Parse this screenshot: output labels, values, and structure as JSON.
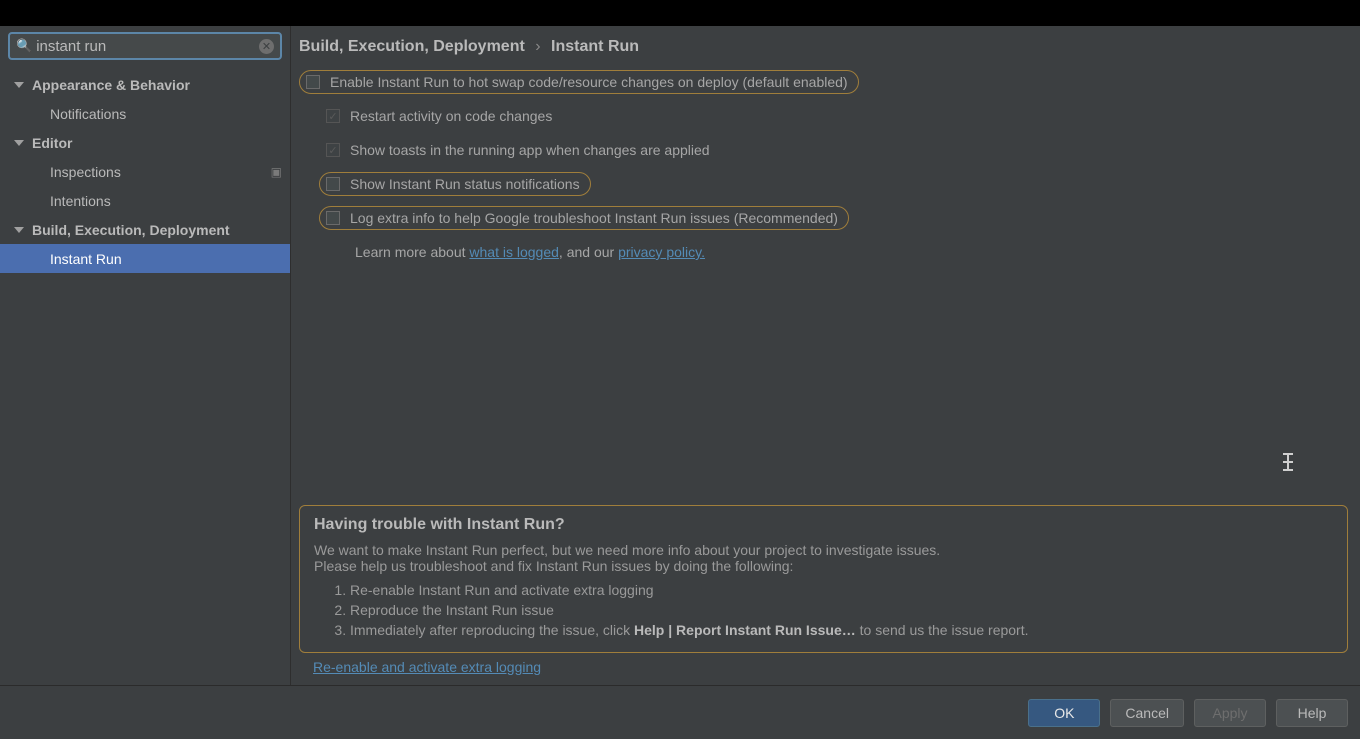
{
  "search": {
    "value": "instant run"
  },
  "sidebar": {
    "groups": [
      {
        "label": "Appearance & Behavior",
        "children": [
          {
            "label": "Notifications"
          }
        ]
      },
      {
        "label": "Editor",
        "children": [
          {
            "label": "Inspections",
            "badge": true
          },
          {
            "label": "Intentions"
          }
        ]
      },
      {
        "label": "Build, Execution, Deployment",
        "children": [
          {
            "label": "Instant Run",
            "selected": true
          }
        ]
      }
    ]
  },
  "breadcrumb": {
    "root": "Build, Execution, Deployment",
    "leaf": "Instant Run"
  },
  "options": {
    "enable": "Enable Instant Run to hot swap code/resource changes on deploy (default enabled)",
    "restart": "Restart activity on code changes",
    "toasts": "Show toasts in the running app when changes are applied",
    "status": "Show Instant Run status notifications",
    "logextra": "Log extra info to help Google troubleshoot Instant Run issues (Recommended)"
  },
  "learn": {
    "prefix": "Learn more about ",
    "link1": "what is logged",
    "mid": ", and our ",
    "link2": "privacy policy."
  },
  "trouble": {
    "title": "Having trouble with Instant Run?",
    "l1": "We want to make Instant Run perfect, but we need more info about your project to investigate issues.",
    "l2": "Please help us troubleshoot and fix Instant Run issues by doing the following:",
    "step1": "Re-enable Instant Run and activate extra logging",
    "step2": "Reproduce the Instant Run issue",
    "step3a": "Immediately after reproducing the issue, click ",
    "step3b": "Help | Report Instant Run Issue…",
    "step3c": " to send us the issue report.",
    "reenable": "Re-enable and activate extra logging"
  },
  "buttons": {
    "ok": "OK",
    "cancel": "Cancel",
    "apply": "Apply",
    "help": "Help"
  }
}
